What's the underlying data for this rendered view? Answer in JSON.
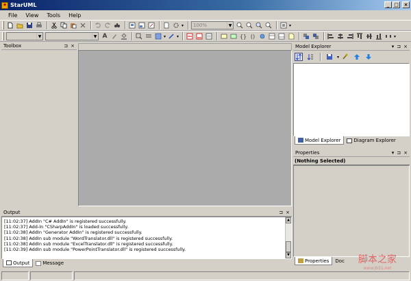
{
  "window": {
    "title": "StarUML",
    "title_icon": "staruml-logo-icon",
    "controls": [
      "_",
      "□",
      "×"
    ]
  },
  "menu": {
    "items": [
      "File",
      "View",
      "Tools",
      "Help"
    ]
  },
  "toolbar": {
    "zoom_value": "100%",
    "font_combo_value": ""
  },
  "toolbox": {
    "title": "Toolbox",
    "pin_glyph": "⊐",
    "close_glyph": "×"
  },
  "model_explorer": {
    "title": "Model Explorer",
    "tabs": [
      {
        "label": "Model Explorer",
        "icon": "tree-icon",
        "active": true
      },
      {
        "label": "Diagram Explorer",
        "icon": "diagram-icon",
        "active": false
      }
    ]
  },
  "properties": {
    "title": "Properties",
    "selection_label": "(Nothing Selected)",
    "tabs": [
      {
        "label": "Properties",
        "active": true
      },
      {
        "label": "Doc",
        "active": false
      }
    ]
  },
  "output": {
    "title": "Output",
    "lines": [
      "[11:02:37]  AddIn \"C# AddIn\" is registered successfully.",
      "[11:02:37]  Add-In \"CSharpAddIn\" is loaded successfully.",
      "[11:02:38]  AddIn \"Generator AddIn\" is registered successfully.",
      "[11:02:38]  AddIn sub module \"WordTranslator.dll\" is registered successfully.",
      "[11:02:38]  AddIn sub module \"ExcelTranslator.dll\" is registered successfully.",
      "[11:02:39]  AddIn sub module \"PowerPointTranslator.dll\" is registered successfully."
    ],
    "tabs": [
      {
        "label": "Output",
        "active": true
      },
      {
        "label": "Message",
        "active": false
      }
    ]
  },
  "watermark": {
    "text": "脚本之家",
    "sub": "www.jb51.net"
  },
  "colors": {
    "title_gradient_start": "#0a246a",
    "title_gradient_end": "#a6caf0",
    "chrome": "#d4d0c8",
    "canvas": "#ababab"
  }
}
